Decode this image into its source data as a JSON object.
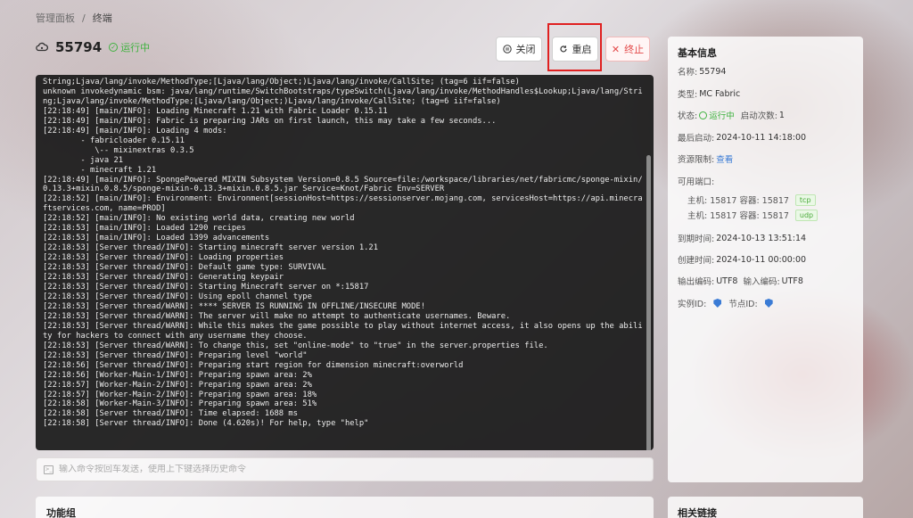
{
  "breadcrumb": {
    "home": "管理面板",
    "separator": "/",
    "current": "终端"
  },
  "instance": {
    "id": "55794",
    "status": "运行中"
  },
  "buttons": {
    "close": "关闭",
    "restart": "重启",
    "stop": "终止"
  },
  "console": {
    "lines": [
      "String;Ljava/lang/invoke/MethodType;[Ljava/lang/Object;)Ljava/lang/invoke/CallSite; (tag=6 iif=false)",
      "unknown invokedynamic bsm: java/lang/runtime/SwitchBootstraps/typeSwitch(Ljava/lang/invoke/MethodHandles$Lookup;Ljava/lang/String;Ljava/lang/invoke/MethodType;[Ljava/lang/Object;)Ljava/lang/invoke/CallSite; (tag=6 iif=false)",
      "[22:18:49] [main/INFO]: Loading Minecraft 1.21 with Fabric Loader 0.15.11",
      "[22:18:49] [main/INFO]: Fabric is preparing JARs on first launch, this may take a few seconds...",
      "[22:18:49] [main/INFO]: Loading 4 mods:",
      "        - fabricloader 0.15.11",
      "           \\-- mixinextras 0.3.5",
      "        - java 21",
      "        - minecraft 1.21",
      "[22:18:49] [main/INFO]: SpongePowered MIXIN Subsystem Version=0.8.5 Source=file:/workspace/libraries/net/fabricmc/sponge-mixin/0.13.3+mixin.0.8.5/sponge-mixin-0.13.3+mixin.0.8.5.jar Service=Knot/Fabric Env=SERVER",
      "[22:18:52] [main/INFO]: Environment: Environment[sessionHost=https://sessionserver.mojang.com, servicesHost=https://api.minecraftservices.com, name=PROD]",
      "[22:18:52] [main/INFO]: No existing world data, creating new world",
      "[22:18:53] [main/INFO]: Loaded 1290 recipes",
      "[22:18:53] [main/INFO]: Loaded 1399 advancements",
      "[22:18:53] [Server thread/INFO]: Starting minecraft server version 1.21",
      "[22:18:53] [Server thread/INFO]: Loading properties",
      "[22:18:53] [Server thread/INFO]: Default game type: SURVIVAL",
      "[22:18:53] [Server thread/INFO]: Generating keypair",
      "[22:18:53] [Server thread/INFO]: Starting Minecraft server on *:15817",
      "[22:18:53] [Server thread/INFO]: Using epoll channel type",
      "[22:18:53] [Server thread/WARN]: **** SERVER IS RUNNING IN OFFLINE/INSECURE MODE!",
      "[22:18:53] [Server thread/WARN]: The server will make no attempt to authenticate usernames. Beware.",
      "[22:18:53] [Server thread/WARN]: While this makes the game possible to play without internet access, it also opens up the ability for hackers to connect with any username they choose.",
      "[22:18:53] [Server thread/WARN]: To change this, set \"online-mode\" to \"true\" in the server.properties file.",
      "[22:18:53] [Server thread/INFO]: Preparing level \"world\"",
      "[22:18:56] [Server thread/INFO]: Preparing start region for dimension minecraft:overworld",
      "[22:18:56] [Worker-Main-1/INFO]: Preparing spawn area: 2%",
      "[22:18:57] [Worker-Main-2/INFO]: Preparing spawn area: 2%",
      "[22:18:57] [Worker-Main-2/INFO]: Preparing spawn area: 18%",
      "[22:18:58] [Worker-Main-3/INFO]: Preparing spawn area: 51%",
      "[22:18:58] [Server thread/INFO]: Time elapsed: 1688 ms",
      "[22:18:58] [Server thread/INFO]: Done (4.620s)! For help, type \"help\""
    ]
  },
  "command_input": {
    "placeholder": "输入命令按回车发送，使用上下键选择历史命令"
  },
  "functions_panel": {
    "title": "功能组"
  },
  "info": {
    "title": "基本信息",
    "name_label": "名称:",
    "name_value": "55794",
    "type_label": "类型:",
    "type_value": "MC Fabric",
    "state_label": "状态:",
    "state_value": "运行中",
    "launch_count_label": "启动次数:",
    "launch_count_value": "1",
    "last_start_label": "最后启动:",
    "last_start_value": "2024-10-11 14:18:00",
    "resource_label": "资源限制:",
    "resource_link": "查看",
    "ports_label": "可用端口:",
    "ports": [
      {
        "text": "主机: 15817 容器: 15817",
        "proto": "tcp"
      },
      {
        "text": "主机: 15817 容器: 15817",
        "proto": "udp"
      }
    ],
    "expire_label": "到期时间:",
    "expire_value": "2024-10-13 13:51:14",
    "created_label": "创建时间:",
    "created_value": "2024-10-11 00:00:00",
    "encoding_label": "输出编码:",
    "output_encoding": "UTF8",
    "input_encoding_label": "输入编码:",
    "input_encoding": "UTF8",
    "instance_id_label": "实例ID:",
    "node_id_label": "节点ID:"
  },
  "links_panel": {
    "title": "相关链接"
  },
  "colors": {
    "running_green": "#3fb23f",
    "stop_red": "#e34848",
    "link_blue": "#3a7bd5",
    "highlight_red": "#e02020"
  }
}
